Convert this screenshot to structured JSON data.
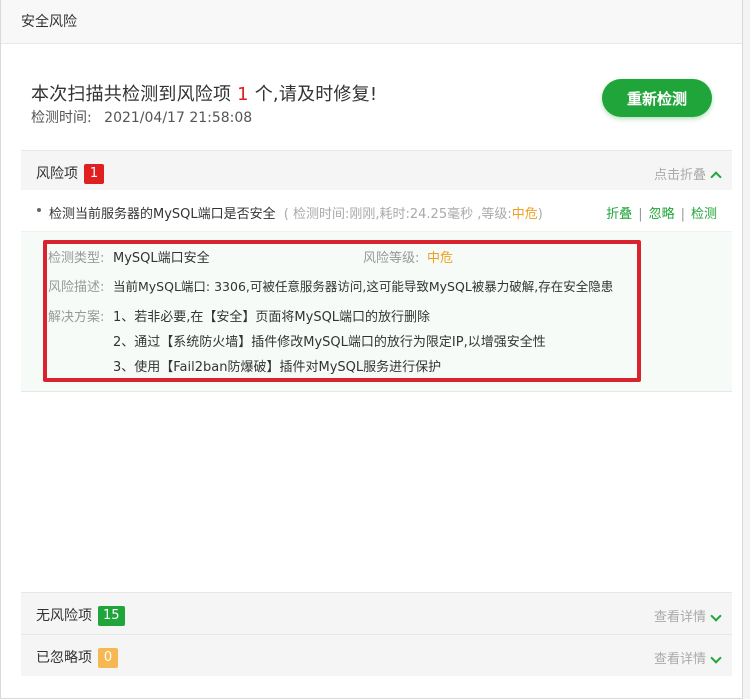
{
  "dialog": {
    "title": "安全风险"
  },
  "summary": {
    "text_before": "本次扫描共检测到风险项",
    "risk_count": "1",
    "text_after": "个,请及时修复!",
    "scan_time_label": "检测时间:",
    "scan_time_value": "2021/04/17 21:58:08",
    "recheck_button": "重新检测"
  },
  "sections": {
    "risk": {
      "label": "风险项",
      "count": "1",
      "toggle": "点击折叠"
    },
    "no_risk": {
      "label": "无风险项",
      "count": "15",
      "toggle": "查看详情"
    },
    "ignored": {
      "label": "已忽略项",
      "count": "0",
      "toggle": "查看详情"
    }
  },
  "risk_item": {
    "title": "检测当前服务器的MySQL端口是否安全",
    "meta_prefix": "( 检测时间:刚刚,耗时:24.25毫秒 ,等级:",
    "meta_level": "中危",
    "meta_suffix": ")",
    "actions": [
      "折叠",
      "忽略",
      "检测"
    ]
  },
  "risk_detail": {
    "type_label": "检测类型:",
    "type_value": "MySQL端口安全",
    "level_label": "风险等级:",
    "level_value": "中危",
    "desc_label": "风险描述:",
    "desc_value": "当前MySQL端口: 3306,可被任意服务器访问,这可能导致MySQL被暴力破解,存在安全隐患",
    "solution_label": "解决方案:",
    "solutions": [
      "1、若非必要,在【安全】页面将MySQL端口的放行删除",
      "2、通过【系统防火墙】插件修改MySQL端口的放行为限定IP,以增强安全性",
      "3、使用【Fail2ban防爆破】插件对MySQL服务进行保护"
    ]
  },
  "colors": {
    "accent": "#20a53a",
    "danger": "#e02020",
    "warning": "#f0a020",
    "highlight_border": "#d9232e"
  }
}
